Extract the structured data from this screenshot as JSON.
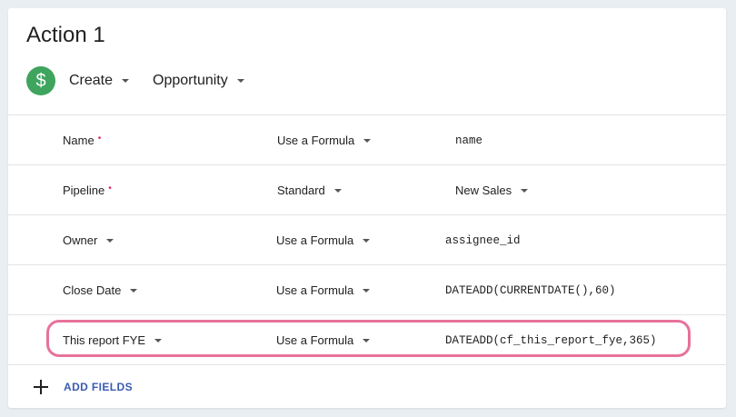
{
  "action": {
    "title": "Action 1",
    "operation": "Create",
    "record_type": "Opportunity",
    "icon": "dollar-icon",
    "icon_color": "#3fa45d"
  },
  "fields": [
    {
      "label": "Name",
      "required": true,
      "mode": "Use a Formula",
      "value": "name",
      "value_style": "formula"
    },
    {
      "label": "Pipeline",
      "required": true,
      "mode": "Standard",
      "value": "New Sales",
      "value_style": "select"
    },
    {
      "label": "Owner",
      "required": false,
      "mode": "Use a Formula",
      "value": "assignee_id",
      "value_style": "formula"
    },
    {
      "label": "Close Date",
      "required": false,
      "mode": "Use a Formula",
      "value": "DATEADD(CURRENTDATE(),60)",
      "value_style": "formula"
    },
    {
      "label": "This report FYE",
      "required": false,
      "mode": "Use a Formula",
      "value": "DATEADD(cf_this_report_fye,365)",
      "value_style": "formula",
      "highlighted": true
    }
  ],
  "required_marker": "•",
  "add_fields_label": "ADD FIELDS",
  "highlight_color": "#e7729c",
  "link_color": "#3b5bb3"
}
